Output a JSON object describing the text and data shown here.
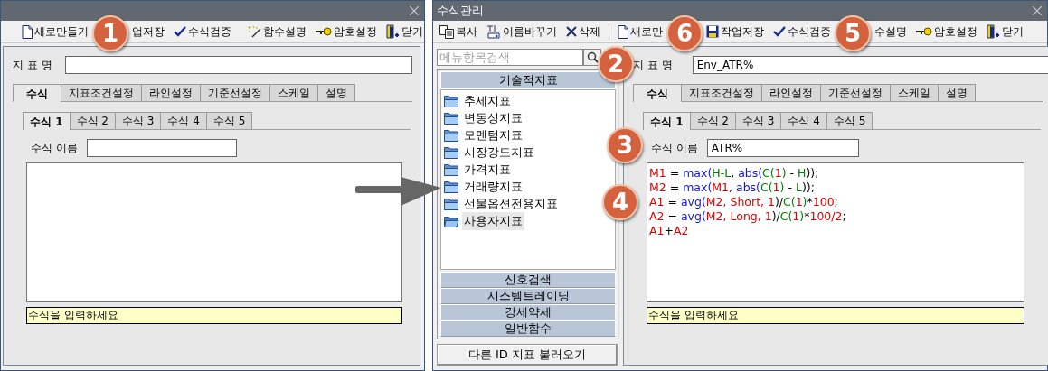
{
  "windows": [
    {
      "toolbar": [
        [
          {
            "kind": "new",
            "label": "새로만들기"
          },
          {
            "kind": "text",
            "label": "업저장"
          },
          {
            "kind": "check",
            "label": "수식검증"
          }
        ],
        [
          {
            "kind": "wand",
            "label": "함수설명"
          },
          {
            "kind": "key",
            "label": "암호설정"
          },
          {
            "kind": "door",
            "label": "닫기"
          }
        ]
      ],
      "panel": {
        "indicator_label": "지 표 명",
        "tabs": [
          {
            "label": "수식",
            "selected": true
          },
          {
            "label": "지표조건설정",
            "selected": false
          },
          {
            "label": "라인설정",
            "selected": false
          },
          {
            "label": "기준선설정",
            "selected": false
          },
          {
            "label": "스케일",
            "selected": false
          },
          {
            "label": "설명",
            "selected": false
          }
        ],
        "formula_tabs": [
          {
            "label": "수식 1",
            "selected": true
          },
          {
            "label": "수식 2",
            "selected": false
          },
          {
            "label": "수식 3",
            "selected": false
          },
          {
            "label": "수식 4",
            "selected": false
          },
          {
            "label": "수식 5",
            "selected": false
          }
        ],
        "formula_name_label": "수식 이름",
        "hint": "수식을 입력하세요"
      }
    },
    {
      "title": "수식관리",
      "toolbar": [
        [
          {
            "kind": "copy",
            "label": "복사"
          },
          {
            "kind": "rename",
            "label": "이름바꾸기"
          },
          {
            "kind": "delete",
            "label": "삭제"
          }
        ],
        [
          {
            "kind": "new",
            "label": "새로만"
          },
          {
            "kind": "save",
            "label": "작업저장"
          },
          {
            "kind": "check",
            "label": "수식검증"
          },
          {
            "kind": "text",
            "label": "수설명"
          },
          {
            "kind": "key",
            "label": "암호설정"
          },
          {
            "kind": "door",
            "label": "닫기"
          }
        ]
      ],
      "menu": {
        "search": {
          "placeholder": "메뉴항목검색"
        },
        "sections": [
          {
            "label": "기술적지표",
            "expanded": true,
            "items": [
              {
                "label": "추세지표",
                "selected": false
              },
              {
                "label": "변동성지표",
                "selected": false
              },
              {
                "label": "모멘텀지표",
                "selected": false
              },
              {
                "label": "시장강도지표",
                "selected": false
              },
              {
                "label": "가격지표",
                "selected": false
              },
              {
                "label": "거래량지표",
                "selected": false
              },
              {
                "label": "선물옵션전용지표",
                "selected": false
              },
              {
                "label": "사용자지표",
                "selected": true
              }
            ]
          },
          {
            "label": "신호검색",
            "expanded": false
          },
          {
            "label": "시스템트레이딩",
            "expanded": false
          },
          {
            "label": "강세약세",
            "expanded": false
          },
          {
            "label": "일반함수",
            "expanded": false
          }
        ],
        "load_button": "다른 ID 지표 불러오기"
      },
      "panel": {
        "indicator_label": "지 표 명",
        "indicator_value": "Env_ATR%",
        "tabs": [
          {
            "label": "수식",
            "selected": true
          },
          {
            "label": "지표조건설정",
            "selected": false
          },
          {
            "label": "라인설정",
            "selected": false
          },
          {
            "label": "기준선설정",
            "selected": false
          },
          {
            "label": "스케일",
            "selected": false
          },
          {
            "label": "설명",
            "selected": false
          }
        ],
        "formula_tabs": [
          {
            "label": "수식 1",
            "selected": true
          },
          {
            "label": "수식 2",
            "selected": false
          },
          {
            "label": "수식 3",
            "selected": false
          },
          {
            "label": "수식 4",
            "selected": false
          },
          {
            "label": "수식 5",
            "selected": false
          }
        ],
        "formula_name_label": "수식 이름",
        "formula_name_value": "ATR%",
        "lines": [
          [
            {
              "kind": "var",
              "text": "M1"
            },
            {
              "kind": "plain",
              "text": " = "
            },
            {
              "kind": "func",
              "text": "max("
            },
            {
              "kind": "builtin",
              "text": "H-L"
            },
            {
              "kind": "plain",
              "text": ", "
            },
            {
              "kind": "func",
              "text": "abs("
            },
            {
              "kind": "builtin",
              "text": "C("
            },
            {
              "kind": "var",
              "text": "1"
            },
            {
              "kind": "builtin",
              "text": ")"
            },
            {
              "kind": "plain",
              "text": " - "
            },
            {
              "kind": "builtin",
              "text": "H"
            },
            {
              "kind": "plain",
              "text": "));"
            }
          ],
          [
            {
              "kind": "var",
              "text": "M2"
            },
            {
              "kind": "plain",
              "text": " = "
            },
            {
              "kind": "func",
              "text": "max("
            },
            {
              "kind": "var",
              "text": "M1"
            },
            {
              "kind": "plain",
              "text": ", "
            },
            {
              "kind": "func",
              "text": "abs("
            },
            {
              "kind": "builtin",
              "text": "C("
            },
            {
              "kind": "var",
              "text": "1"
            },
            {
              "kind": "builtin",
              "text": ")"
            },
            {
              "kind": "plain",
              "text": " - "
            },
            {
              "kind": "builtin",
              "text": "L"
            },
            {
              "kind": "plain",
              "text": "));"
            }
          ],
          [
            {
              "kind": "var",
              "text": "A1"
            },
            {
              "kind": "plain",
              "text": " = "
            },
            {
              "kind": "func",
              "text": "avg("
            },
            {
              "kind": "var",
              "text": "M2, Short, 1"
            },
            {
              "kind": "plain",
              "text": ")/"
            },
            {
              "kind": "builtin",
              "text": "C("
            },
            {
              "kind": "var",
              "text": "1"
            },
            {
              "kind": "builtin",
              "text": ")"
            },
            {
              "kind": "plain",
              "text": "*"
            },
            {
              "kind": "var",
              "text": "100"
            },
            {
              "kind": "plain",
              "text": ";"
            }
          ],
          [
            {
              "kind": "var",
              "text": "A2"
            },
            {
              "kind": "plain",
              "text": " = "
            },
            {
              "kind": "func",
              "text": "avg("
            },
            {
              "kind": "var",
              "text": "M2, Long, 1"
            },
            {
              "kind": "plain",
              "text": ")/"
            },
            {
              "kind": "builtin",
              "text": "C("
            },
            {
              "kind": "var",
              "text": "1"
            },
            {
              "kind": "builtin",
              "text": ")"
            },
            {
              "kind": "plain",
              "text": "*"
            },
            {
              "kind": "var",
              "text": "100/2"
            },
            {
              "kind": "plain",
              "text": ";"
            }
          ],
          [
            {
              "kind": "var",
              "text": "A1"
            },
            {
              "kind": "plain",
              "text": "+"
            },
            {
              "kind": "var",
              "text": "A2"
            }
          ]
        ],
        "hint": "수식을 입력하세요"
      }
    }
  ],
  "callouts": [
    "1",
    "6",
    "5",
    "2",
    "3",
    "4"
  ]
}
